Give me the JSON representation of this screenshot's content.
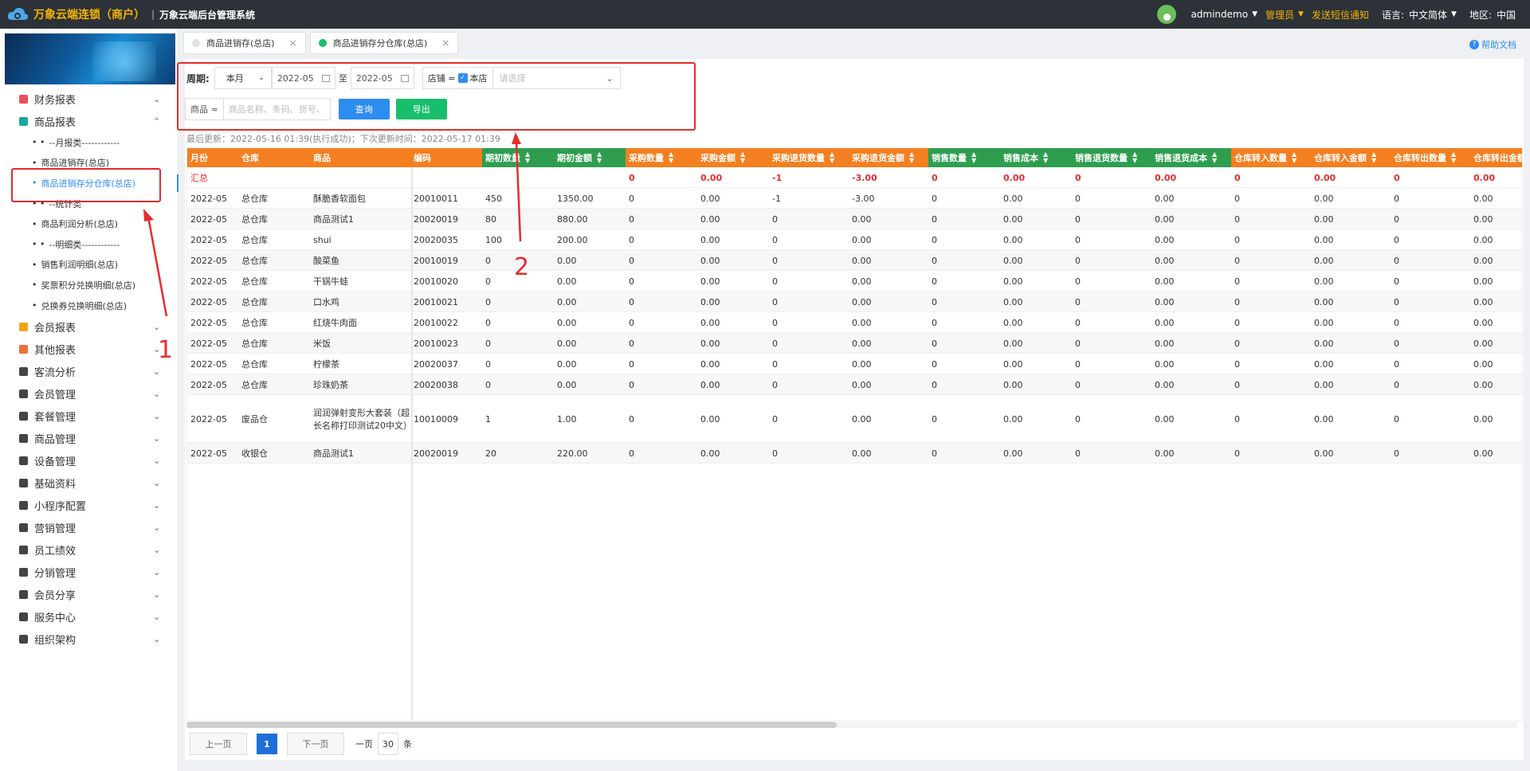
{
  "header": {
    "brand": "万象云端连锁（商户）",
    "divider": "|",
    "system_name": "万象云端后台管理系统",
    "user": "admindemo",
    "role": "管理员",
    "sms": "发送短信通知",
    "lang_label": "语言:",
    "lang_value": "中文简体",
    "region_label": "地区:",
    "region_value": "中国"
  },
  "sidebar": {
    "groups": [
      {
        "label": "财务报表",
        "icon": "finance-report-icon",
        "color": "#e8515b"
      },
      {
        "label": "商品报表",
        "icon": "product-report-icon",
        "color": "#19a8a0"
      }
    ],
    "sub_items": [
      {
        "label": "--月报类------------",
        "bullet": "• •"
      },
      {
        "label": "商品进销存(总店)",
        "bullet": "•"
      },
      {
        "label": "商品进销存分仓库(总店)",
        "bullet": "•"
      },
      {
        "label": "--统计类",
        "bullet": "• •"
      },
      {
        "label": "商品利润分析(总店)",
        "bullet": "•"
      },
      {
        "label": "--明细类------------",
        "bullet": "• •"
      },
      {
        "label": "销售利润明细(总店)",
        "bullet": "•"
      },
      {
        "label": "奖票积分兑换明细(总店)",
        "bullet": "•"
      },
      {
        "label": "兑换券兑换明细(总店)",
        "bullet": "•"
      }
    ],
    "more_groups": [
      {
        "label": "会员报表",
        "icon": "member-report-icon",
        "color": "#f4a21a"
      },
      {
        "label": "其他报表",
        "icon": "other-report-icon",
        "color": "#e8703b"
      },
      {
        "label": "客流分析",
        "icon": "traffic-icon",
        "color": "#444"
      },
      {
        "label": "会员管理",
        "icon": "member-icon",
        "color": "#444"
      },
      {
        "label": "套餐管理",
        "icon": "package-icon",
        "color": "#444"
      },
      {
        "label": "商品管理",
        "icon": "product-icon",
        "color": "#444"
      },
      {
        "label": "设备管理",
        "icon": "device-icon",
        "color": "#444"
      },
      {
        "label": "基础资料",
        "icon": "basic-data-icon",
        "color": "#444"
      },
      {
        "label": "小程序配置",
        "icon": "miniapp-icon",
        "color": "#444"
      },
      {
        "label": "营销管理",
        "icon": "marketing-icon",
        "color": "#444"
      },
      {
        "label": "员工绩效",
        "icon": "performance-icon",
        "color": "#444"
      },
      {
        "label": "分销管理",
        "icon": "distribution-icon",
        "color": "#444"
      },
      {
        "label": "会员分享",
        "icon": "share-icon",
        "color": "#444"
      },
      {
        "label": "服务中心",
        "icon": "service-icon",
        "color": "#444"
      },
      {
        "label": "组织架构",
        "icon": "org-icon",
        "color": "#444"
      }
    ]
  },
  "tabs": [
    {
      "label": "商品进销存(总店)",
      "dot": "#e0e0e0",
      "close": "×"
    },
    {
      "label": "商品进销存分仓库(总店)",
      "dot": "#19be6b",
      "close": "×"
    }
  ],
  "help": "帮助文档",
  "filters": {
    "period_label": "周期:",
    "period_value": "本月",
    "date_from": "2022-05",
    "to": "至",
    "date_to": "2022-05",
    "shop_label": "店铺 =",
    "shop_check": "本店",
    "shop_placeholder": "请选择",
    "product_label": "商品 ≈",
    "product_placeholder": "商品名称、条码、货号、",
    "query": "查询",
    "export": "导出"
  },
  "updated_text": "最后更新：2022-05-16 01:39(执行成功)；下次更新时间：2022-05-17 01:39",
  "table": {
    "columns": [
      {
        "label": "月份",
        "sort": false,
        "color": "#f47f20"
      },
      {
        "label": "仓库",
        "sort": false,
        "color": "#f47f20"
      },
      {
        "label": "商品",
        "sort": false,
        "color": "#f47f20"
      },
      {
        "label": "编码",
        "sort": false,
        "color": "#f47f20"
      },
      {
        "label": "期初数量",
        "sort": true,
        "color": "#2e9e4e"
      },
      {
        "label": "期初金额",
        "sort": true,
        "color": "#2e9e4e"
      },
      {
        "label": "采购数量",
        "sort": true,
        "color": "#f47f20"
      },
      {
        "label": "采购金额",
        "sort": true,
        "color": "#f47f20"
      },
      {
        "label": "采购退货数量",
        "sort": true,
        "color": "#f47f20"
      },
      {
        "label": "采购退货金额",
        "sort": true,
        "color": "#f47f20"
      },
      {
        "label": "销售数量",
        "sort": true,
        "color": "#2e9e4e"
      },
      {
        "label": "销售成本",
        "sort": true,
        "color": "#2e9e4e"
      },
      {
        "label": "销售退货数量",
        "sort": true,
        "color": "#2e9e4e"
      },
      {
        "label": "销售退货成本",
        "sort": true,
        "color": "#2e9e4e"
      },
      {
        "label": "仓库转入数量",
        "sort": true,
        "color": "#f47f20"
      },
      {
        "label": "仓库转入金额",
        "sort": true,
        "color": "#f47f20"
      },
      {
        "label": "仓库转出数量",
        "sort": true,
        "color": "#f47f20"
      },
      {
        "label": "仓库转出金额",
        "sort": true,
        "color": "#f47f20"
      }
    ],
    "summary": [
      "汇总",
      "",
      "",
      "",
      "",
      "",
      "0",
      "0.00",
      "-1",
      "-3.00",
      "0",
      "0.00",
      "0",
      "0.00",
      "0",
      "0.00",
      "0",
      "0.00"
    ],
    "rows": [
      [
        "2022-05",
        "总仓库",
        "酥脆香软面包",
        "20010011",
        "450",
        "1350.00",
        "0",
        "0.00",
        "-1",
        "-3.00",
        "0",
        "0.00",
        "0",
        "0.00",
        "0",
        "0.00",
        "0",
        "0.00"
      ],
      [
        "2022-05",
        "总仓库",
        "商品测试1",
        "20020019",
        "80",
        "880.00",
        "0",
        "0.00",
        "0",
        "0.00",
        "0",
        "0.00",
        "0",
        "0.00",
        "0",
        "0.00",
        "0",
        "0.00"
      ],
      [
        "2022-05",
        "总仓库",
        "shui",
        "20020035",
        "100",
        "200.00",
        "0",
        "0.00",
        "0",
        "0.00",
        "0",
        "0.00",
        "0",
        "0.00",
        "0",
        "0.00",
        "0",
        "0.00"
      ],
      [
        "2022-05",
        "总仓库",
        "酸菜鱼",
        "20010019",
        "0",
        "0.00",
        "0",
        "0.00",
        "0",
        "0.00",
        "0",
        "0.00",
        "0",
        "0.00",
        "0",
        "0.00",
        "0",
        "0.00"
      ],
      [
        "2022-05",
        "总仓库",
        "干锅牛蛙",
        "20010020",
        "0",
        "0.00",
        "0",
        "0.00",
        "0",
        "0.00",
        "0",
        "0.00",
        "0",
        "0.00",
        "0",
        "0.00",
        "0",
        "0.00"
      ],
      [
        "2022-05",
        "总仓库",
        "口水鸡",
        "20010021",
        "0",
        "0.00",
        "0",
        "0.00",
        "0",
        "0.00",
        "0",
        "0.00",
        "0",
        "0.00",
        "0",
        "0.00",
        "0",
        "0.00"
      ],
      [
        "2022-05",
        "总仓库",
        "红烧牛肉面",
        "20010022",
        "0",
        "0.00",
        "0",
        "0.00",
        "0",
        "0.00",
        "0",
        "0.00",
        "0",
        "0.00",
        "0",
        "0.00",
        "0",
        "0.00"
      ],
      [
        "2022-05",
        "总仓库",
        "米饭",
        "20010023",
        "0",
        "0.00",
        "0",
        "0.00",
        "0",
        "0.00",
        "0",
        "0.00",
        "0",
        "0.00",
        "0",
        "0.00",
        "0",
        "0.00"
      ],
      [
        "2022-05",
        "总仓库",
        "柠檬茶",
        "20020037",
        "0",
        "0.00",
        "0",
        "0.00",
        "0",
        "0.00",
        "0",
        "0.00",
        "0",
        "0.00",
        "0",
        "0.00",
        "0",
        "0.00"
      ],
      [
        "2022-05",
        "总仓库",
        "珍珠奶茶",
        "20020038",
        "0",
        "0.00",
        "0",
        "0.00",
        "0",
        "0.00",
        "0",
        "0.00",
        "0",
        "0.00",
        "0",
        "0.00",
        "0",
        "0.00"
      ],
      [
        "2022-05",
        "废品仓",
        "润润弹射变形大套装（超长名称打印测试20中文）",
        "10010009",
        "1",
        "1.00",
        "0",
        "0.00",
        "0",
        "0.00",
        "0",
        "0.00",
        "0",
        "0.00",
        "0",
        "0.00",
        "0",
        "0.00"
      ],
      [
        "2022-05",
        "收银仓",
        "商品测试1",
        "20020019",
        "20",
        "220.00",
        "0",
        "0.00",
        "0",
        "0.00",
        "0",
        "0.00",
        "0",
        "0.00",
        "0",
        "0.00",
        "0",
        "0.00"
      ]
    ]
  },
  "pager": {
    "prev": "上一页",
    "current": "1",
    "next": "下一页",
    "per_page_prefix": "一页",
    "per_page": "30",
    "per_page_suffix": "条"
  },
  "annotations": [
    "1",
    "2"
  ]
}
